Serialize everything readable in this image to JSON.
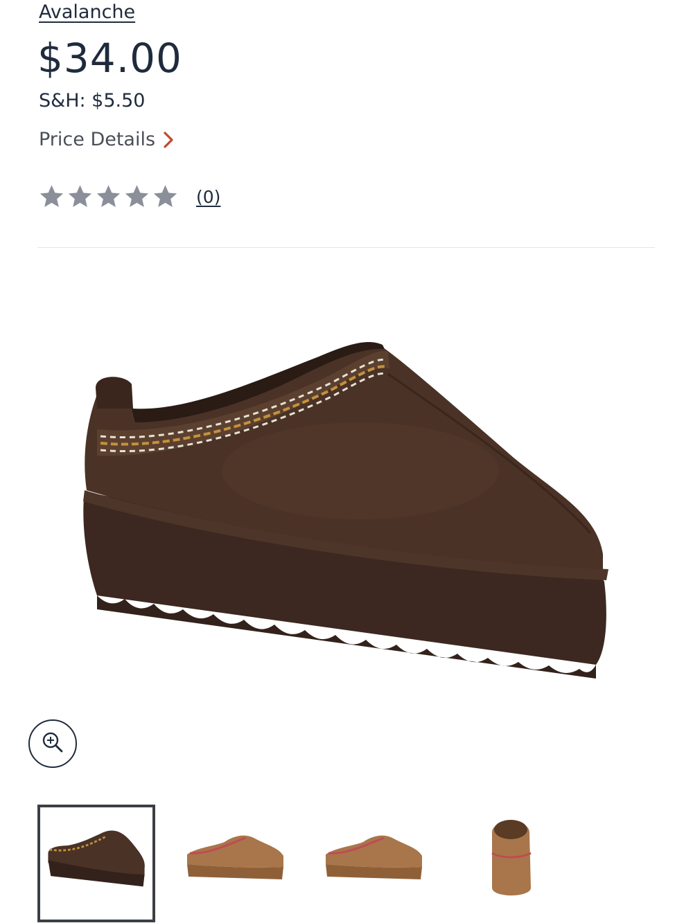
{
  "product": {
    "brand": "Avalanche",
    "price": "$34.00",
    "shipping": "S&H: $5.50",
    "price_details_label": "Price Details",
    "rating": {
      "stars_filled": 0,
      "stars_total": 5,
      "review_count": "(0)"
    }
  },
  "gallery": {
    "zoom_icon": "zoom-in-icon",
    "thumbnails": [
      {
        "name": "thumbnail-brown-side",
        "selected": true
      },
      {
        "name": "thumbnail-chestnut-side",
        "selected": false
      },
      {
        "name": "thumbnail-chestnut-side-alt",
        "selected": false
      },
      {
        "name": "thumbnail-chestnut-back",
        "selected": false
      },
      {
        "name": "thumbnail-chestnut-partial",
        "selected": false
      }
    ]
  },
  "colors": {
    "text": "#1f2b3d",
    "chevron": "#c0482c",
    "star_empty": "#8a8f99",
    "shoe_brown": "#4a3226",
    "shoe_chestnut": "#a8764a"
  }
}
